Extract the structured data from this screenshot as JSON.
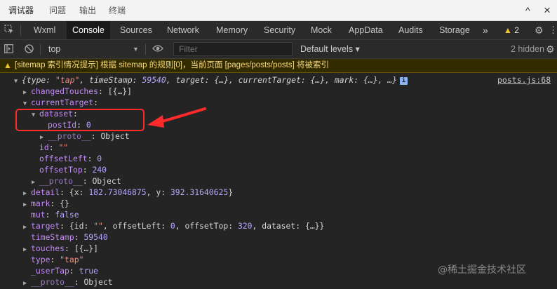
{
  "top_tabs": [
    "调试器",
    "问题",
    "输出",
    "终端"
  ],
  "top_icons": {
    "chevron": "^",
    "close": "×"
  },
  "devtools_tabs": [
    "Wxml",
    "Console",
    "Sources",
    "Network",
    "Memory",
    "Security",
    "Mock",
    "AppData",
    "Audits",
    "Storage"
  ],
  "more_tabs": "»",
  "warning_count": "2",
  "toolbar": {
    "context": "top",
    "filter_placeholder": "Filter",
    "levels": "Default levels ▾",
    "hidden": "2 hidden"
  },
  "warning_message": "[sitemap 索引情况提示] 根据 sitemap 的规则[0]，当前页面 [pages/posts/posts] 将被索引",
  "source_link": "posts.js:68",
  "console": {
    "summary": {
      "open": "{",
      "k_type": "type",
      "v_type": "\"tap\"",
      "k_ts": "timeStamp",
      "v_ts": "59540",
      "k_target": "target",
      "v_target": "{…}",
      "k_ct": "currentTarget",
      "v_ct": "{…}",
      "k_mark": "mark",
      "v_mark": "{…}",
      "close": "…}"
    },
    "changedTouches": {
      "key": "changedTouches",
      "value": "[{…}]"
    },
    "currentTarget": {
      "key": "currentTarget"
    },
    "dataset": {
      "key": "dataset"
    },
    "postId": {
      "key": "postId",
      "value": "0"
    },
    "proto_inner": {
      "key": "__proto__",
      "value": "Object"
    },
    "id": {
      "key": "id",
      "value": "\"\""
    },
    "offsetLeft": {
      "key": "offsetLeft",
      "value": "0"
    },
    "offsetTop": {
      "key": "offsetTop",
      "value": "240"
    },
    "proto_ct": {
      "key": "__proto__",
      "value": "Object"
    },
    "detail": {
      "key": "detail",
      "x_key": "x",
      "x_val": "182.73046875",
      "y_key": "y",
      "y_val": "392.31640625"
    },
    "mark": {
      "key": "mark",
      "value": "{}"
    },
    "mut": {
      "key": "mut",
      "value": "false"
    },
    "target": {
      "key": "target",
      "id_key": "id",
      "id_val": "\"\"",
      "ol_key": "offsetLeft",
      "ol_val": "0",
      "ot_key": "offsetTop",
      "ot_val": "320",
      "ds_key": "dataset",
      "ds_val": "{…}"
    },
    "timeStamp": {
      "key": "timeStamp",
      "value": "59540"
    },
    "touches": {
      "key": "touches",
      "value": "[{…}]"
    },
    "type": {
      "key": "type",
      "value": "\"tap\""
    },
    "userTap": {
      "key": "_userTap",
      "value": "true"
    },
    "proto_root": {
      "key": "__proto__",
      "value": "Object"
    }
  },
  "watermark": "@稀土掘金技术社区",
  "colors": {
    "background": "#242424",
    "key": "#8ab4f8",
    "property": "#c58af9",
    "string": "#f28b82",
    "number": "#b4a7ff",
    "warning_text": "#f5d77a",
    "annotation": "#ff2a2a"
  }
}
